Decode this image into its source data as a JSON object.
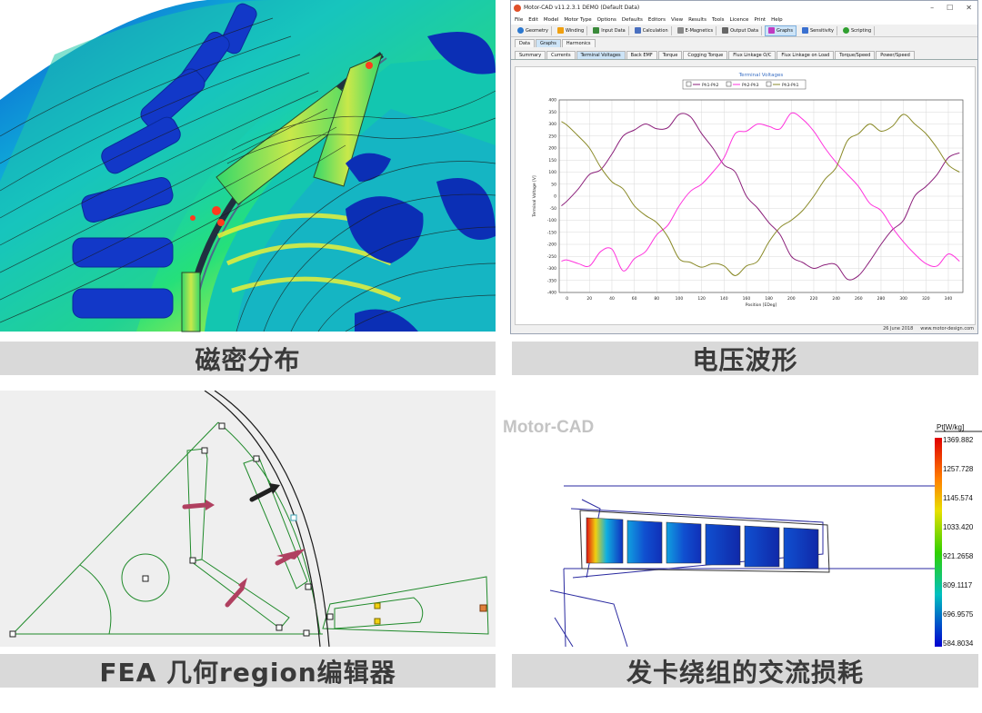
{
  "captions": {
    "top_left": "磁密分布",
    "top_right": "电压波形",
    "bottom_left": "FEA 几何region编辑器",
    "bottom_right": "发卡绕组的交流损耗"
  },
  "motorcad": {
    "window_title": "Motor-CAD v11.2.3.1 DEMO (Default Data)",
    "window_controls": [
      "–",
      "☐",
      "✕"
    ],
    "menu": [
      "File",
      "Edit",
      "Model",
      "Motor Type",
      "Options",
      "Defaults",
      "Editors",
      "View",
      "Results",
      "Tools",
      "Licence",
      "Print",
      "Help"
    ],
    "toolbar": [
      "Geometry",
      "Winding",
      "Input Data",
      "Calculation",
      "E-Magnetics",
      "Output Data",
      "Graphs",
      "Sensitivity",
      "Scripting"
    ],
    "subtabs": [
      "Data",
      "Graphs",
      "Harmonics"
    ],
    "graph_tabs": [
      "Summary",
      "Currents",
      "Terminal Voltages",
      "Back EMF",
      "Torque",
      "Cogging Torque",
      "Flux Linkage O/C",
      "Flux Linkage on Load",
      "Torque/Speed",
      "Power/Speed"
    ],
    "status_date": "26 June 2018",
    "status_url": "www.motor-design.com"
  },
  "colors": {
    "caption_bg": "#d9d9d9",
    "caption_text": "#3a3a3a",
    "series_ph1": "#8b1f7a",
    "series_ph2": "#ff33dd",
    "series_ph3": "#8a8a28",
    "chart_title": "#3a6fc4"
  },
  "chart_data": {
    "type": "line",
    "title": "Terminal Voltages",
    "xlabel": "Position [EDeg]",
    "ylabel": "Terminal Voltage [V]",
    "xlim": [
      -7,
      353
    ],
    "ylim": [
      -400,
      400
    ],
    "xticks": [
      0,
      20,
      40,
      60,
      80,
      100,
      120,
      140,
      160,
      180,
      200,
      220,
      240,
      260,
      280,
      300,
      320,
      340
    ],
    "yticks": [
      400,
      350,
      300,
      250,
      200,
      150,
      100,
      50,
      0,
      -50,
      -100,
      -150,
      -200,
      -250,
      -300,
      -350,
      -400
    ],
    "legend_position": "top-center",
    "grid": true,
    "x": [
      -5,
      0,
      10,
      20,
      30,
      40,
      50,
      60,
      70,
      80,
      90,
      100,
      110,
      120,
      130,
      140,
      150,
      160,
      170,
      180,
      190,
      200,
      210,
      220,
      230,
      240,
      250,
      260,
      270,
      280,
      290,
      300,
      310,
      320,
      330,
      340,
      350
    ],
    "series": [
      {
        "name": "Ph1-Ph2",
        "values": [
          -40,
          -20,
          30,
          90,
          110,
          175,
          250,
          275,
          300,
          280,
          285,
          340,
          330,
          260,
          200,
          130,
          100,
          0,
          -50,
          -110,
          -160,
          -250,
          -275,
          -300,
          -285,
          -285,
          -345,
          -330,
          -270,
          -200,
          -140,
          -100,
          0,
          40,
          90,
          160,
          180
        ]
      },
      {
        "name": "Ph2-Ph3",
        "values": [
          -270,
          -265,
          -280,
          -290,
          -230,
          -220,
          -310,
          -260,
          -230,
          -160,
          -120,
          -40,
          20,
          50,
          100,
          160,
          260,
          270,
          300,
          290,
          280,
          345,
          320,
          270,
          200,
          140,
          90,
          40,
          -30,
          -60,
          -130,
          -190,
          -240,
          -280,
          -290,
          -240,
          -270
        ]
      },
      {
        "name": "Ph3-Ph1",
        "values": [
          310,
          295,
          250,
          200,
          120,
          60,
          30,
          -40,
          -80,
          -110,
          -170,
          -260,
          -275,
          -295,
          -280,
          -290,
          -330,
          -290,
          -270,
          -190,
          -130,
          -100,
          -60,
          0,
          70,
          120,
          230,
          260,
          300,
          270,
          290,
          340,
          300,
          260,
          200,
          130,
          100
        ]
      }
    ]
  },
  "fea": {
    "watermark": "Motor-CAD",
    "colorbar_title": "Pt[W/kg]",
    "colorbar_values": [
      "1369.882",
      "1257.728",
      "1145.574",
      "1033.420",
      "921.2658",
      "809.1117",
      "696.9575",
      "584.8034"
    ]
  }
}
